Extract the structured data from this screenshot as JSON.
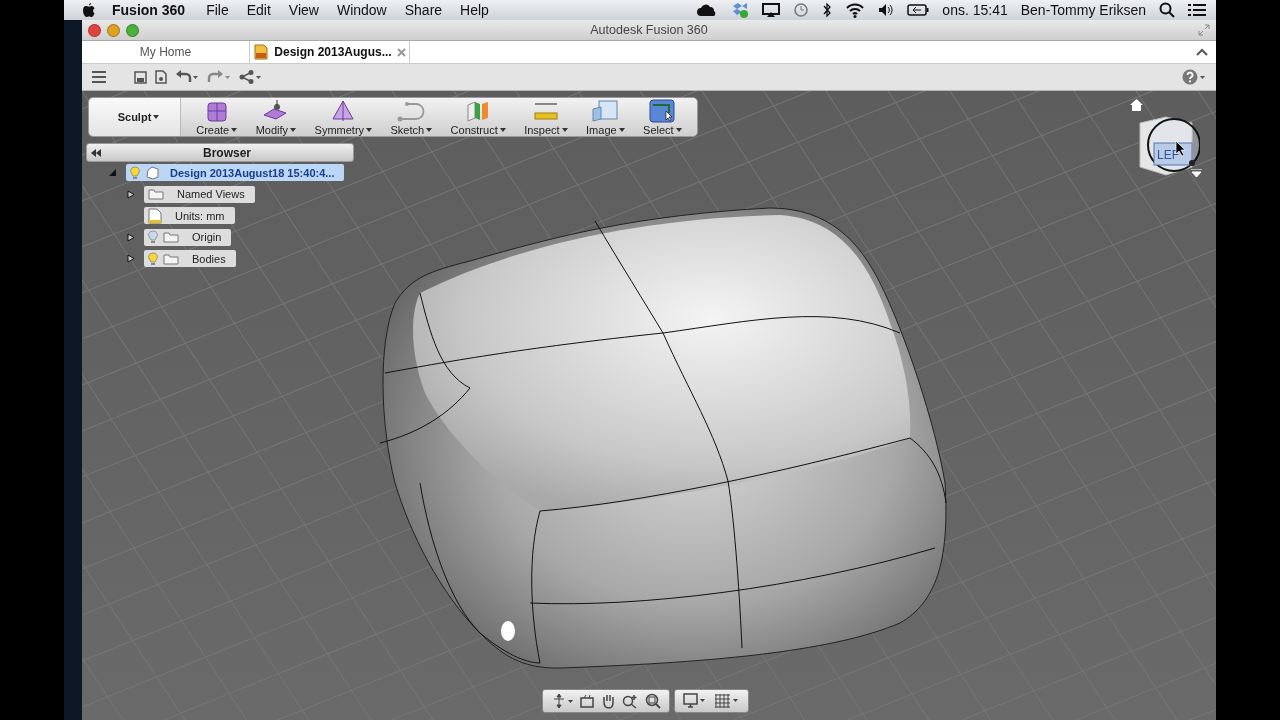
{
  "menu_bar": {
    "app_name": "Fusion 360",
    "items": [
      "File",
      "Edit",
      "View",
      "Window",
      "Share",
      "Help"
    ],
    "clock": "ons. 15:41",
    "user": "Ben-Tommy Eriksen"
  },
  "window": {
    "title": "Autodesk Fusion 360"
  },
  "tabs": [
    {
      "label": "My Home",
      "selected": false
    },
    {
      "label": "Design 2013Augus...",
      "selected": true
    }
  ],
  "toolbar": {
    "workspace": "Sculpt",
    "tools": [
      {
        "label": "Create",
        "kind": "create"
      },
      {
        "label": "Modify",
        "kind": "modify"
      },
      {
        "label": "Symmetry",
        "kind": "symmetry"
      },
      {
        "label": "Sketch",
        "kind": "sketch"
      },
      {
        "label": "Construct",
        "kind": "construct"
      },
      {
        "label": "Inspect",
        "kind": "inspect"
      },
      {
        "label": "Image",
        "kind": "image"
      },
      {
        "label": "Select",
        "kind": "select"
      }
    ]
  },
  "browser": {
    "title": "Browser",
    "root": {
      "label": "Design 2013August18 15:40:4...",
      "selected": true,
      "expanded": true,
      "children": [
        {
          "label": "Named Views",
          "kind": "folder",
          "expanded": false
        },
        {
          "label": "Units: mm",
          "kind": "units"
        },
        {
          "label": "Origin",
          "kind": "toggle",
          "expanded": false,
          "visible": false
        },
        {
          "label": "Bodies",
          "kind": "toggle",
          "expanded": false,
          "visible": true
        }
      ]
    }
  },
  "view_cube": {
    "face": "LEF"
  }
}
